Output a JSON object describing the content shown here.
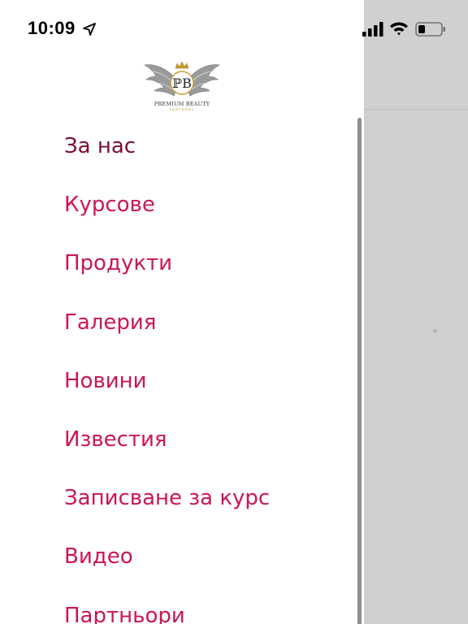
{
  "status_bar": {
    "time": "10:09",
    "icons": [
      "location-arrow-icon",
      "cellular-signal-icon",
      "wifi-icon",
      "battery-icon"
    ]
  },
  "logo": {
    "monogram": "PB",
    "text": "PREMIUM BEAUTY",
    "subtext": "PARTNERS"
  },
  "menu": {
    "items": [
      {
        "label": "За нас",
        "active": true
      },
      {
        "label": "Курсове"
      },
      {
        "label": "Продукти"
      },
      {
        "label": "Галерия"
      },
      {
        "label": "Новини"
      },
      {
        "label": "Известия"
      },
      {
        "label": "Записване за курс"
      },
      {
        "label": "Видео"
      },
      {
        "label": "Партньори"
      }
    ]
  },
  "colors": {
    "accent": "#cc1650",
    "active": "#7d0b32",
    "drawer_bg": "#ffffff",
    "overlay_bg": "#cfcfcf"
  }
}
